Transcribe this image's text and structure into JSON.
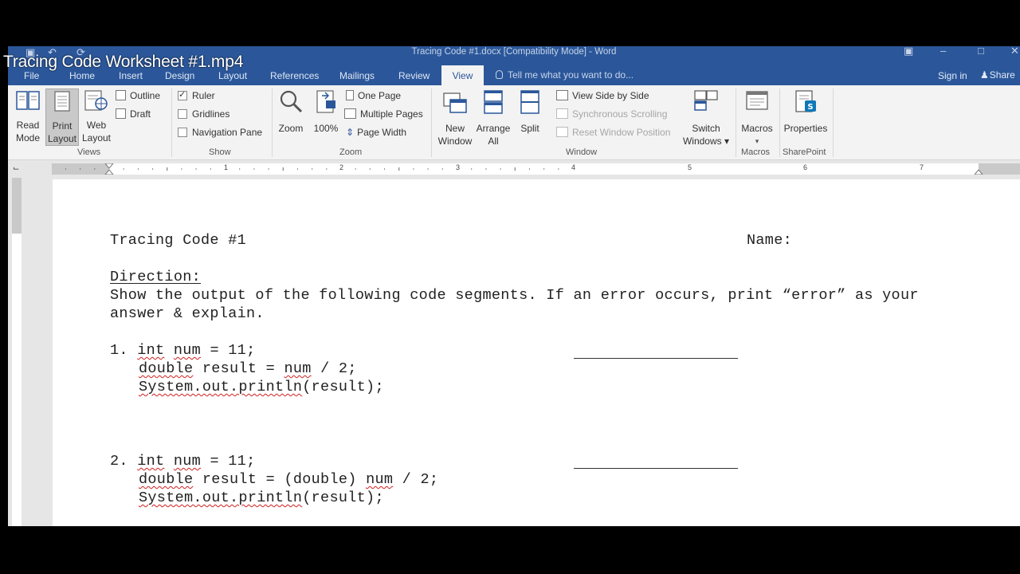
{
  "video": {
    "title": "Tracing Code Worksheet #1.mp4"
  },
  "window": {
    "title": "Tracing Code #1.docx [Compatibility Mode] - Word"
  },
  "tabs": [
    {
      "label": "File"
    },
    {
      "label": "Home"
    },
    {
      "label": "Insert"
    },
    {
      "label": "Design"
    },
    {
      "label": "Layout"
    },
    {
      "label": "References"
    },
    {
      "label": "Mailings"
    },
    {
      "label": "Review"
    },
    {
      "label": "View"
    }
  ],
  "tell_me": "Tell me what you want to do...",
  "sign_in": "Sign in",
  "share": "Share",
  "ribbon": {
    "views": {
      "label": "Views",
      "read_mode": [
        "Read",
        "Mode"
      ],
      "print_layout": [
        "Print",
        "Layout"
      ],
      "web_layout": [
        "Web",
        "Layout"
      ],
      "outline": "Outline",
      "draft": "Draft"
    },
    "show": {
      "label": "Show",
      "ruler": "Ruler",
      "gridlines": "Gridlines",
      "navigation_pane": "Navigation Pane"
    },
    "zoom": {
      "label": "Zoom",
      "zoom": "Zoom",
      "hundred": "100%",
      "one_page": "One Page",
      "multiple_pages": "Multiple Pages",
      "page_width": "Page Width"
    },
    "window": {
      "label": "Window",
      "new_window": [
        "New",
        "Window"
      ],
      "arrange_all": [
        "Arrange",
        "All"
      ],
      "split": "Split",
      "view_side_by_side": "View Side by Side",
      "synchronous_scrolling": "Synchronous Scrolling",
      "reset_window_position": "Reset Window Position",
      "switch_windows": [
        "Switch",
        "Windows ▾"
      ]
    },
    "macros": {
      "label": "Macros",
      "macros": "Macros",
      "arrow": "▾"
    },
    "sharepoint": {
      "label": "SharePoint",
      "properties": "Properties"
    }
  },
  "ruler_numbers": [
    "1",
    "2",
    "3",
    "4",
    "5",
    "6",
    "7"
  ],
  "document": {
    "title": "Tracing Code #1",
    "name_label": "Name:",
    "direction_heading": "Direction:",
    "direction_line1": "Show the output of the following code segments. If an error occurs, print “error” as your",
    "direction_line2": "answer & explain.",
    "q1": {
      "number": "1.",
      "line1_kw": "int",
      "line1_var": "num",
      "line1_rest": " = 11;",
      "line2_kw": "double",
      "line2_mid": " result = ",
      "line2_var": "num",
      "line2_rest": " / 2;",
      "line3": "System.out.println",
      "line3_rest": "(result);"
    },
    "q2": {
      "number": "2.",
      "line1_kw": "int",
      "line1_var": "num",
      "line1_rest": " = 11;",
      "line2_kw": "double",
      "line2_mid": " result = (double) ",
      "line2_var": "num",
      "line2_rest": " / 2;",
      "line3": "System.out.println",
      "line3_rest": "(result);"
    }
  }
}
